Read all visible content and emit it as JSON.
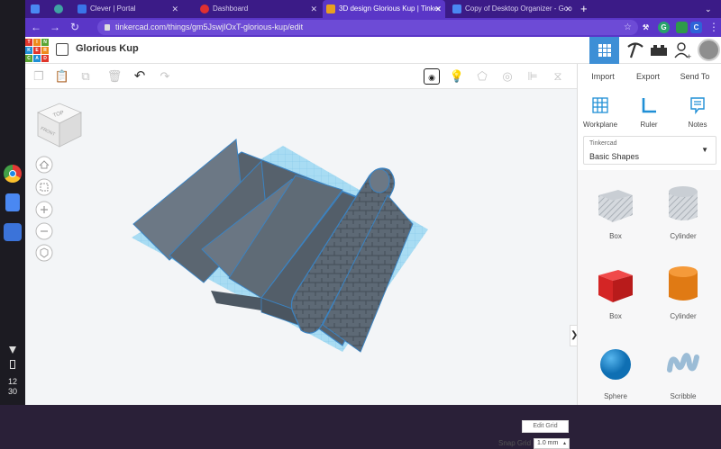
{
  "browser": {
    "tabs": [
      {
        "title": "",
        "icon": "docs-icon",
        "color": "#4a88f2"
      },
      {
        "title": "",
        "icon": "extension-icon",
        "color": "#3fa3a3"
      },
      {
        "title": "Clever | Portal",
        "icon": "clever-icon",
        "color": "#3a74e8"
      },
      {
        "title": "Dashboard",
        "icon": "dashboard-icon",
        "color": "#e03030"
      },
      {
        "title": "3D design Glorious Kup | Tinker",
        "icon": "tinkercad-icon",
        "color": "#e8a020"
      },
      {
        "title": "Copy of Desktop Organizer - Goo",
        "icon": "slides-icon",
        "color": "#4a88f2"
      }
    ],
    "active_tab_index": 4,
    "new_tab_glyph": "+",
    "url": "tinkercad.com/things/gm5JswjIOxT-glorious-kup/edit"
  },
  "shelf": {
    "time_hour": "12",
    "time_min": "30"
  },
  "app": {
    "design_title": "Glorious Kup",
    "logo_letters": [
      "TIN",
      "KER",
      "CAD"
    ],
    "actions": {
      "import": "Import",
      "export": "Export",
      "send_to": "Send To"
    },
    "panel_tools": {
      "workplane": "Workplane",
      "ruler": "Ruler",
      "notes": "Notes"
    },
    "shape_source": "Tinkercad",
    "shape_category": "Basic Shapes",
    "shapes": [
      {
        "label": "Box",
        "color": "#c8cdd4",
        "kind": "box-hole"
      },
      {
        "label": "Cylinder",
        "color": "#c8cdd4",
        "kind": "cylinder-hole"
      },
      {
        "label": "Box",
        "color": "#e02a2a",
        "kind": "box"
      },
      {
        "label": "Cylinder",
        "color": "#e68118",
        "kind": "cylinder"
      },
      {
        "label": "Sphere",
        "color": "#1f8fd6",
        "kind": "sphere"
      },
      {
        "label": "Scribble",
        "color": "#9bbcd6",
        "kind": "scribble"
      }
    ],
    "view_cube": {
      "top": "TOP",
      "front": "FRONT"
    },
    "edit_grid": "Edit Grid",
    "snap_grid_label": "Snap Grid",
    "snap_grid_value": "1.0 mm"
  },
  "colors": {
    "accent": "#3d8fd6",
    "chrome_purple": "#5a36c7",
    "model_gray": "#5e6a75",
    "workplane_blue": "#a8dcf3"
  }
}
